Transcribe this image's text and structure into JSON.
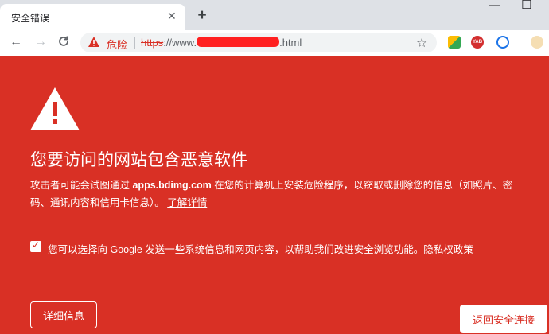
{
  "tab": {
    "title": "安全错误",
    "close_glyph": "✕"
  },
  "window": {
    "minimize_glyph": "—",
    "maximize_glyph": "☐"
  },
  "toolbar": {
    "back_glyph": "←",
    "forward_glyph": "→",
    "reload_glyph": "C",
    "security_label": "危险",
    "url_protocol": "https",
    "url_host_visible": "://www.",
    "url_suffix": ".html",
    "star_glyph": "☆"
  },
  "extensions": [
    {
      "icon": "color-extension-icon",
      "color": "#4caf50"
    },
    {
      "icon": "yab-extension-icon",
      "label": "YAB",
      "color": "#d32f2f"
    },
    {
      "icon": "block-extension-icon",
      "color": "#1a73e8"
    },
    {
      "icon": "avatar-extension-icon",
      "color": "#8d6e63"
    }
  ],
  "interstitial": {
    "heading": "您要访问的网站包含恶意软件",
    "desc_prefix": "攻击者可能会试图通过 ",
    "desc_domain": "apps.bdimg.com",
    "desc_middle": " 在您的计算机上安装危险程序，以窃取或删除您的信息（如照片、密码、通讯内容和信用卡信息）。",
    "learn_more": "了解详情",
    "optin_text": "您可以选择向 Google 发送一些系统信息和网页内容，以帮助我们改进安全浏览功能。",
    "privacy_link": "隐私权政策",
    "details_button": "详细信息",
    "back_button": "返回安全连接"
  },
  "colors": {
    "danger_red": "#d93025",
    "white": "#ffffff"
  }
}
